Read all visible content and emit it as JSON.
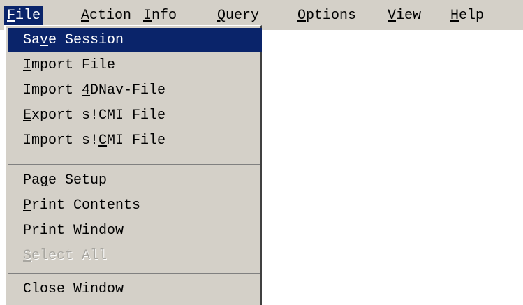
{
  "menubar": {
    "items": [
      {
        "pre": "",
        "accel": "F",
        "post": "ile"
      },
      {
        "pre": "",
        "accel": "A",
        "post": "ction"
      },
      {
        "pre": "",
        "accel": "I",
        "post": "nfo"
      },
      {
        "pre": "",
        "accel": "Q",
        "post": "uery"
      },
      {
        "pre": "",
        "accel": "O",
        "post": "ptions"
      },
      {
        "pre": "",
        "accel": "V",
        "post": "iew"
      },
      {
        "pre": "",
        "accel": "H",
        "post": "elp"
      }
    ]
  },
  "file_menu": {
    "items": [
      {
        "pre": "Sa",
        "accel": "v",
        "post": "e Session",
        "state": "highlighted"
      },
      {
        "pre": "",
        "accel": "I",
        "post": "mport File",
        "state": "normal"
      },
      {
        "pre": "Import ",
        "accel": "4",
        "post": "DNav-File",
        "state": "normal"
      },
      {
        "pre": "",
        "accel": "E",
        "post": "xport s!CMI File",
        "state": "normal"
      },
      {
        "pre": "Import s!",
        "accel": "C",
        "post": "MI File",
        "state": "normal"
      },
      {
        "pre": "Pa",
        "accel": "g",
        "post": "e Setup",
        "state": "normal"
      },
      {
        "pre": "",
        "accel": "P",
        "post": "rint Contents",
        "state": "normal"
      },
      {
        "pre": "Print Window",
        "accel": "",
        "post": "",
        "state": "normal"
      },
      {
        "pre": "",
        "accel": "S",
        "post": "elect All",
        "state": "disabled"
      },
      {
        "pre": "Close Window",
        "accel": "",
        "post": "",
        "state": "normal"
      }
    ]
  },
  "colors": {
    "menu_background": "#d4d0c8",
    "highlight": "#0a246a",
    "highlight_text": "#ffffff",
    "disabled_text": "#a8a6a0"
  }
}
